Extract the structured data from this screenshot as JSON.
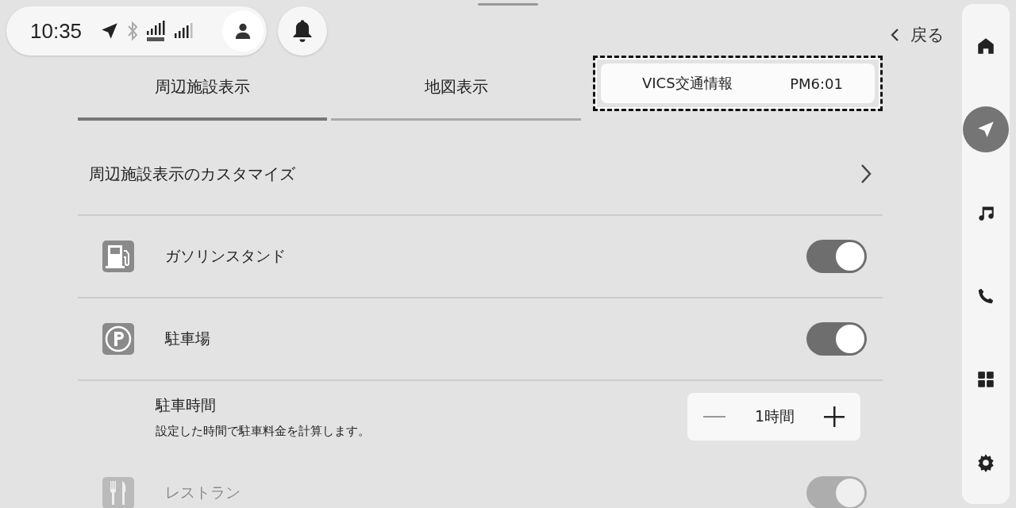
{
  "status": {
    "time": "10:35"
  },
  "back": {
    "label": "戻る"
  },
  "tabs": [
    {
      "kind": "tab",
      "label": "周辺施設表示",
      "selected": true
    },
    {
      "kind": "tab",
      "label": "地図表示",
      "selected": false
    },
    {
      "kind": "info",
      "label": "VICS交通情報",
      "time": "PM6:01",
      "focused": true
    }
  ],
  "customize": {
    "label": "周辺施設表示のカスタマイズ"
  },
  "rows": [
    {
      "kind": "toggle",
      "label": "ガソリンスタンド",
      "on": true,
      "disabled": false
    },
    {
      "kind": "toggle",
      "label": "駐車場",
      "on": true,
      "disabled": false
    },
    {
      "kind": "stepper",
      "title": "駐車時間",
      "description": "設定した時間で駐車料金を計算します。",
      "value": "1時間"
    },
    {
      "kind": "toggle",
      "label": "レストラン",
      "on": true,
      "disabled": true
    }
  ],
  "sidebar": {
    "items": [
      {
        "selected": false
      },
      {
        "selected": true
      },
      {
        "selected": false
      },
      {
        "selected": false
      },
      {
        "selected": false
      },
      {
        "selected": false
      }
    ]
  }
}
